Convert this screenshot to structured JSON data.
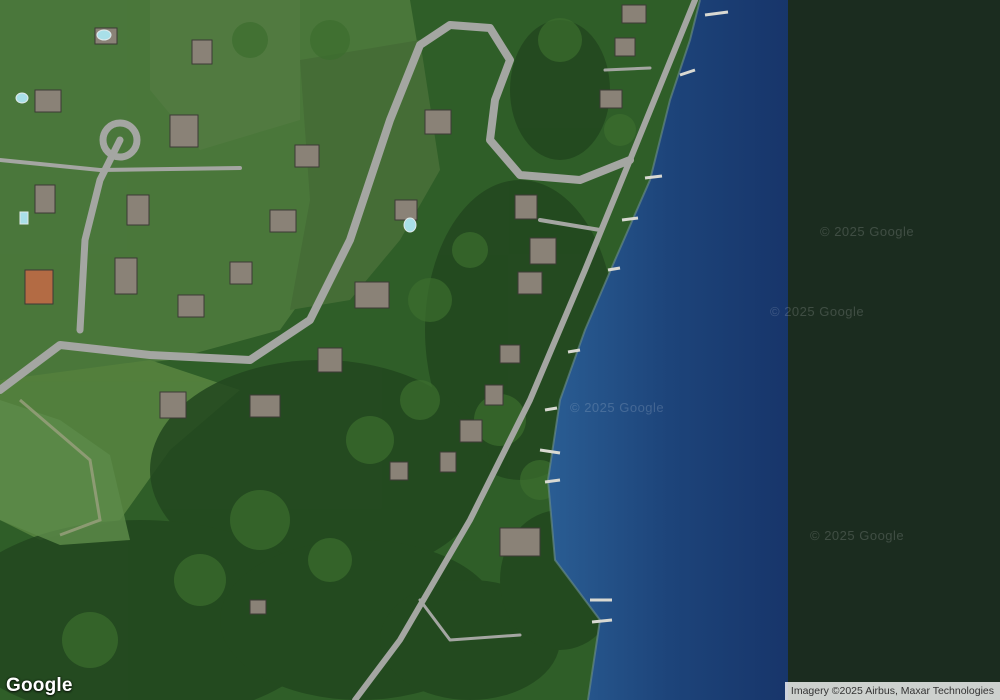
{
  "map": {
    "type": "satellite",
    "colors": {
      "forest": "#2e5e27",
      "lawn": "#4d7a3e",
      "road": "#a7a9a6",
      "lake_shallow": "#1f4f86",
      "lake_deep": "#15305c",
      "shadow_water": "#1a2a1e"
    }
  },
  "watermarks": [
    "© 2025 Google",
    "© 2025 Google",
    "© 2025 Google",
    "© 2025 Google"
  ],
  "branding": {
    "logo": "Google",
    "attribution": "Imagery ©2025 Airbus, Maxar Technologies"
  }
}
